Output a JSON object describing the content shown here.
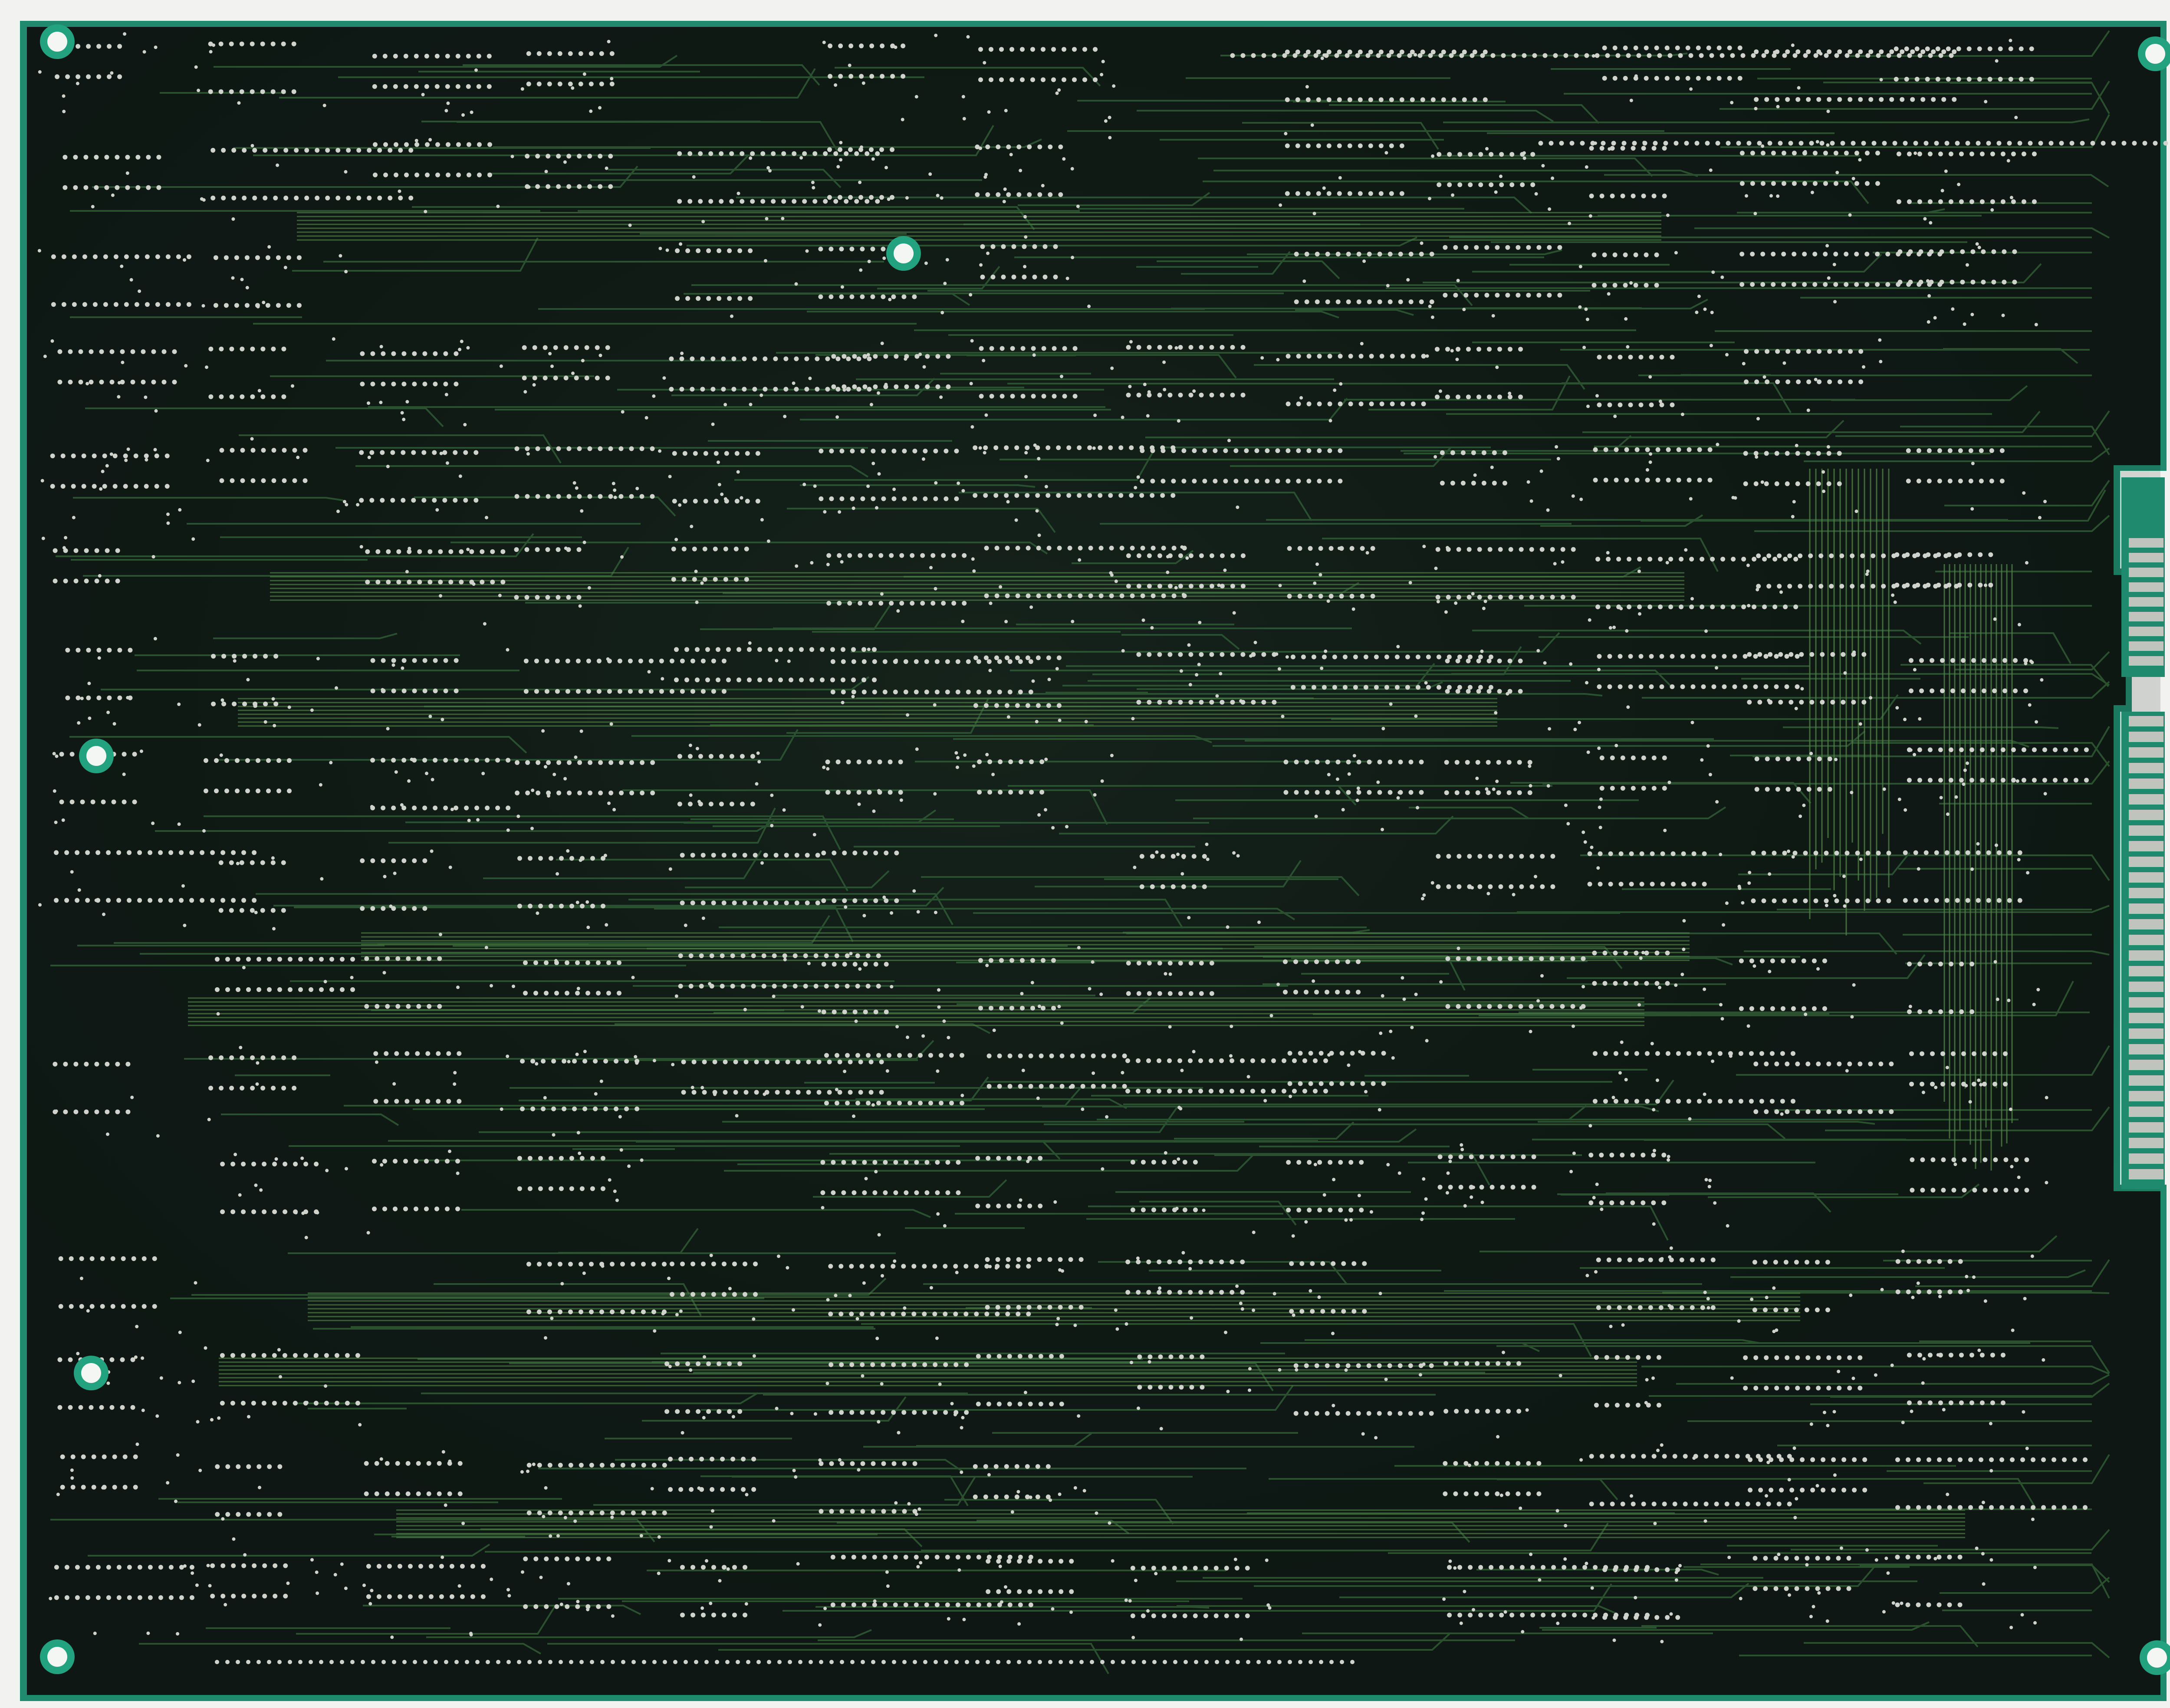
{
  "image": {
    "subject": "printed-circuit-board-solder-side",
    "colors": {
      "background": "#f2f3f1",
      "board_edge": "#1f8a6d",
      "board_body": "#0e1713",
      "board_body_light": "#16241c",
      "trace": "#2f5a34",
      "trace_bright": "#4f7f46",
      "solder_pad": "#cfd3cc",
      "hole_ring": "#22a27f",
      "hole_center": "#f4f6f3",
      "edge_connector": "#bfc4bd"
    },
    "features": {
      "mounting_holes": 7,
      "edge_connectors": 2,
      "via_count_estimate": 6000
    }
  }
}
